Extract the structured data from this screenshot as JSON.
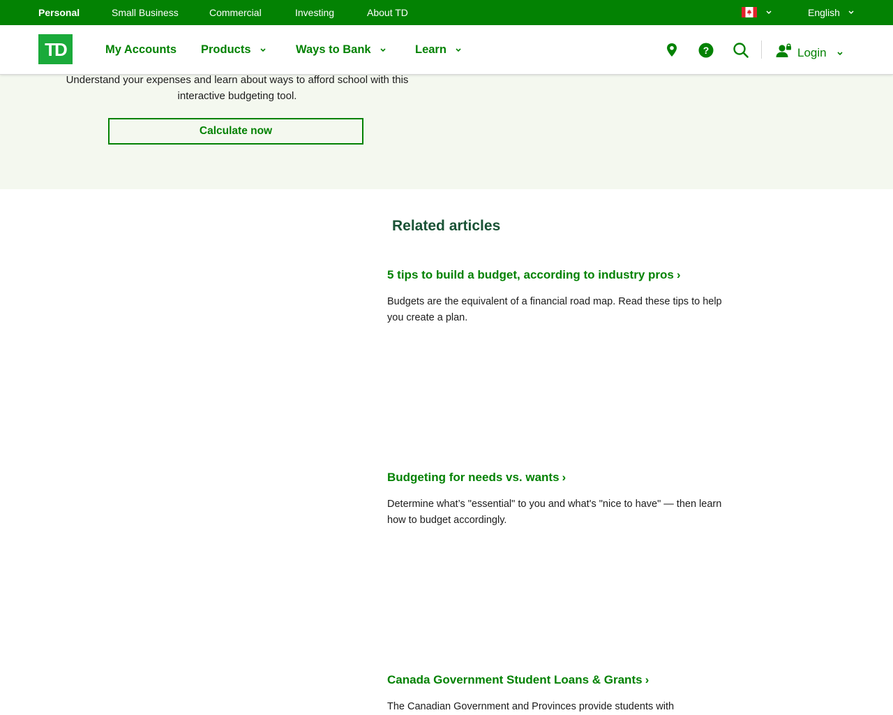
{
  "topbar": {
    "segments": [
      "Personal",
      "Small Business",
      "Commercial",
      "Investing",
      "About TD"
    ],
    "language": "English",
    "country_flag": "canada-flag-icon"
  },
  "nav": {
    "logo_text": "TD",
    "items": [
      "My Accounts",
      "Products",
      "Ways to Bank",
      "Learn"
    ],
    "login": "Login",
    "icons": [
      "location-pin-icon",
      "help-icon",
      "search-icon",
      "user-lock-icon"
    ]
  },
  "hero": {
    "description": "Understand your expenses and learn about ways to afford school with this interactive budgeting tool.",
    "button": "Calculate now"
  },
  "related": {
    "title": "Related articles",
    "articles": [
      {
        "title": "5 tips to build a budget, according to industry pros",
        "desc": "Budgets are the equivalent of a financial road map. Read these tips to help you create a plan."
      },
      {
        "title": "Budgeting for needs vs. wants",
        "desc": "Determine what’s \"essential\" to you and what's \"nice to have\" — then learn how to budget accordingly."
      },
      {
        "title": "Canada Government Student Loans & Grants",
        "desc": "The Canadian Government and Provinces provide students with"
      }
    ]
  },
  "colors": {
    "brand_green": "#038203",
    "hero_bg": "#f4f8ef",
    "heading_dark_green": "#1a5336"
  }
}
